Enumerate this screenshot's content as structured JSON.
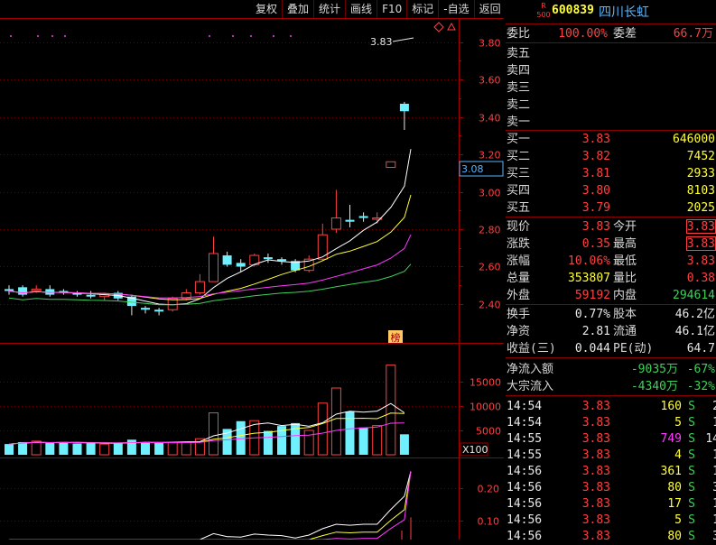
{
  "toolbar": {
    "buttons": [
      "复权",
      "叠加",
      "统计",
      "画线",
      "F10",
      "标记",
      "-自选",
      "返回"
    ]
  },
  "stock": {
    "badge_top": "R",
    "badge_bottom": "500",
    "code": "600839",
    "name": "四川长虹"
  },
  "weibi": {
    "label": "委比",
    "value": "100.00%",
    "label2": "委差",
    "value2": "66.7万"
  },
  "sell_levels": [
    {
      "label": "卖五"
    },
    {
      "label": "卖四"
    },
    {
      "label": "卖三"
    },
    {
      "label": "卖二"
    },
    {
      "label": "卖一"
    }
  ],
  "buy_levels": [
    {
      "label": "买一",
      "price": "3.83",
      "vol": "646000"
    },
    {
      "label": "买二",
      "price": "3.82",
      "vol": "7452"
    },
    {
      "label": "买三",
      "price": "3.81",
      "vol": "2933"
    },
    {
      "label": "买四",
      "price": "3.80",
      "vol": "8103"
    },
    {
      "label": "买五",
      "price": "3.79",
      "vol": "2025"
    }
  ],
  "quote": [
    {
      "l1": "现价",
      "v1": "3.83",
      "l2": "今开",
      "v2": "3.83"
    },
    {
      "l1": "涨跌",
      "v1": "0.35",
      "l2": "最高",
      "v2": "3.83"
    },
    {
      "l1": "涨幅",
      "v1": "10.06%",
      "l2": "最低",
      "v2": "3.83"
    },
    {
      "l1": "总量",
      "v1": "353807",
      "l2": "量比",
      "v2": "0.38"
    },
    {
      "l1": "外盘",
      "v1": "59192",
      "l2": "内盘",
      "v2": "294614"
    }
  ],
  "stats": [
    {
      "l1": "换手",
      "v1": "0.77%",
      "l2": "股本",
      "v2": "46.2亿"
    },
    {
      "l1": "净资",
      "v1": "2.81",
      "l2": "流通",
      "v2": "46.1亿"
    },
    {
      "l1": "收益(三)",
      "v1": "0.044",
      "l2": "PE(动)",
      "v2": "64.7"
    }
  ],
  "flows": [
    {
      "label": "净流入额",
      "value": "-9035万",
      "pct": "-67%"
    },
    {
      "label": "大宗流入",
      "value": "-4340万",
      "pct": "-32%"
    }
  ],
  "ticks": [
    {
      "time": "14:54",
      "price": "3.83",
      "vol": "160",
      "side": "S",
      "n": "2"
    },
    {
      "time": "14:54",
      "price": "3.83",
      "vol": "5",
      "side": "S",
      "n": "1"
    },
    {
      "time": "14:55",
      "price": "3.83",
      "vol": "749",
      "side": "S",
      "n": "14"
    },
    {
      "time": "14:55",
      "price": "3.83",
      "vol": "4",
      "side": "S",
      "n": "1"
    },
    {
      "time": "14:56",
      "price": "3.83",
      "vol": "361",
      "side": "S",
      "n": "1"
    },
    {
      "time": "14:56",
      "price": "3.83",
      "vol": "80",
      "side": "S",
      "n": "3"
    },
    {
      "time": "14:56",
      "price": "3.83",
      "vol": "17",
      "side": "S",
      "n": "1"
    },
    {
      "time": "14:56",
      "price": "3.83",
      "vol": "5",
      "side": "S",
      "n": "1"
    },
    {
      "time": "14:56",
      "price": "3.83",
      "vol": "80",
      "side": "S",
      "n": "3"
    }
  ],
  "chart_data": {
    "type": "candlestick",
    "price_axis": {
      "ticks": [
        3.8,
        3.6,
        3.4,
        3.2,
        3.0,
        2.8,
        2.6,
        2.4
      ],
      "labels": [
        "3.80",
        "3.60",
        "3.40",
        "3.20",
        "3.00",
        "2.80",
        "2.60",
        "2.40"
      ]
    },
    "current_price_label": "3.08",
    "max_annotation": "3.83",
    "marker_label": "榜",
    "candles": [
      {
        "o": 2.48,
        "c": 2.47,
        "h": 2.5,
        "l": 2.45
      },
      {
        "o": 2.49,
        "c": 2.45,
        "h": 2.5,
        "l": 2.44
      },
      {
        "o": 2.47,
        "c": 2.48,
        "h": 2.5,
        "l": 2.46
      },
      {
        "o": 2.48,
        "c": 2.45,
        "h": 2.5,
        "l": 2.44
      },
      {
        "o": 2.47,
        "c": 2.46,
        "h": 2.48,
        "l": 2.45
      },
      {
        "o": 2.46,
        "c": 2.45,
        "h": 2.47,
        "l": 2.44
      },
      {
        "o": 2.45,
        "c": 2.44,
        "h": 2.47,
        "l": 2.43
      },
      {
        "o": 2.44,
        "c": 2.45,
        "h": 2.46,
        "l": 2.42
      },
      {
        "o": 2.46,
        "c": 2.43,
        "h": 2.47,
        "l": 2.42
      },
      {
        "o": 2.44,
        "c": 2.39,
        "h": 2.45,
        "l": 2.34
      },
      {
        "o": 2.38,
        "c": 2.37,
        "h": 2.39,
        "l": 2.35
      },
      {
        "o": 2.37,
        "c": 2.36,
        "h": 2.38,
        "l": 2.34
      },
      {
        "o": 2.37,
        "c": 2.43,
        "h": 2.44,
        "l": 2.36
      },
      {
        "o": 2.43,
        "c": 2.46,
        "h": 2.48,
        "l": 2.42
      },
      {
        "o": 2.46,
        "c": 2.52,
        "h": 2.56,
        "l": 2.45
      },
      {
        "o": 2.52,
        "c": 2.67,
        "h": 2.76,
        "l": 2.52
      },
      {
        "o": 2.66,
        "c": 2.61,
        "h": 2.68,
        "l": 2.6
      },
      {
        "o": 2.62,
        "c": 2.6,
        "h": 2.64,
        "l": 2.57
      },
      {
        "o": 2.61,
        "c": 2.66,
        "h": 2.67,
        "l": 2.6
      },
      {
        "o": 2.65,
        "c": 2.64,
        "h": 2.67,
        "l": 2.62
      },
      {
        "o": 2.64,
        "c": 2.63,
        "h": 2.65,
        "l": 2.61
      },
      {
        "o": 2.63,
        "c": 2.58,
        "h": 2.64,
        "l": 2.57
      },
      {
        "o": 2.58,
        "c": 2.64,
        "h": 2.66,
        "l": 2.57
      },
      {
        "o": 2.64,
        "c": 2.77,
        "h": 2.83,
        "l": 2.63
      },
      {
        "o": 2.8,
        "c": 2.86,
        "h": 3.01,
        "l": 2.78
      },
      {
        "o": 2.85,
        "c": 2.84,
        "h": 2.93,
        "l": 2.81
      },
      {
        "o": 2.87,
        "c": 2.86,
        "h": 2.89,
        "l": 2.84
      },
      {
        "o": 2.86,
        "c": 2.86,
        "h": 2.89,
        "l": 2.83
      },
      {
        "o": 3.13,
        "c": 3.16,
        "h": 3.16,
        "l": 3.13
      },
      {
        "o": 3.47,
        "c": 3.43,
        "h": 3.48,
        "l": 3.33
      }
    ],
    "volume_axis": {
      "labels": [
        "15000",
        "10000",
        "5000"
      ],
      "ticks": [
        15000,
        10000,
        5000
      ],
      "unit": "X100"
    },
    "volumes": [
      2200,
      2600,
      2800,
      2400,
      2600,
      2300,
      2400,
      2200,
      2300,
      3100,
      2600,
      2400,
      2500,
      2600,
      3300,
      8600,
      5300,
      6900,
      7000,
      4900,
      5900,
      6500,
      5000,
      10600,
      13700,
      8900,
      5600,
      6000,
      18400,
      4200
    ],
    "indicator_axis": {
      "labels": [
        "0.20",
        "0.10"
      ],
      "ticks": [
        0.2,
        0.1
      ]
    }
  }
}
